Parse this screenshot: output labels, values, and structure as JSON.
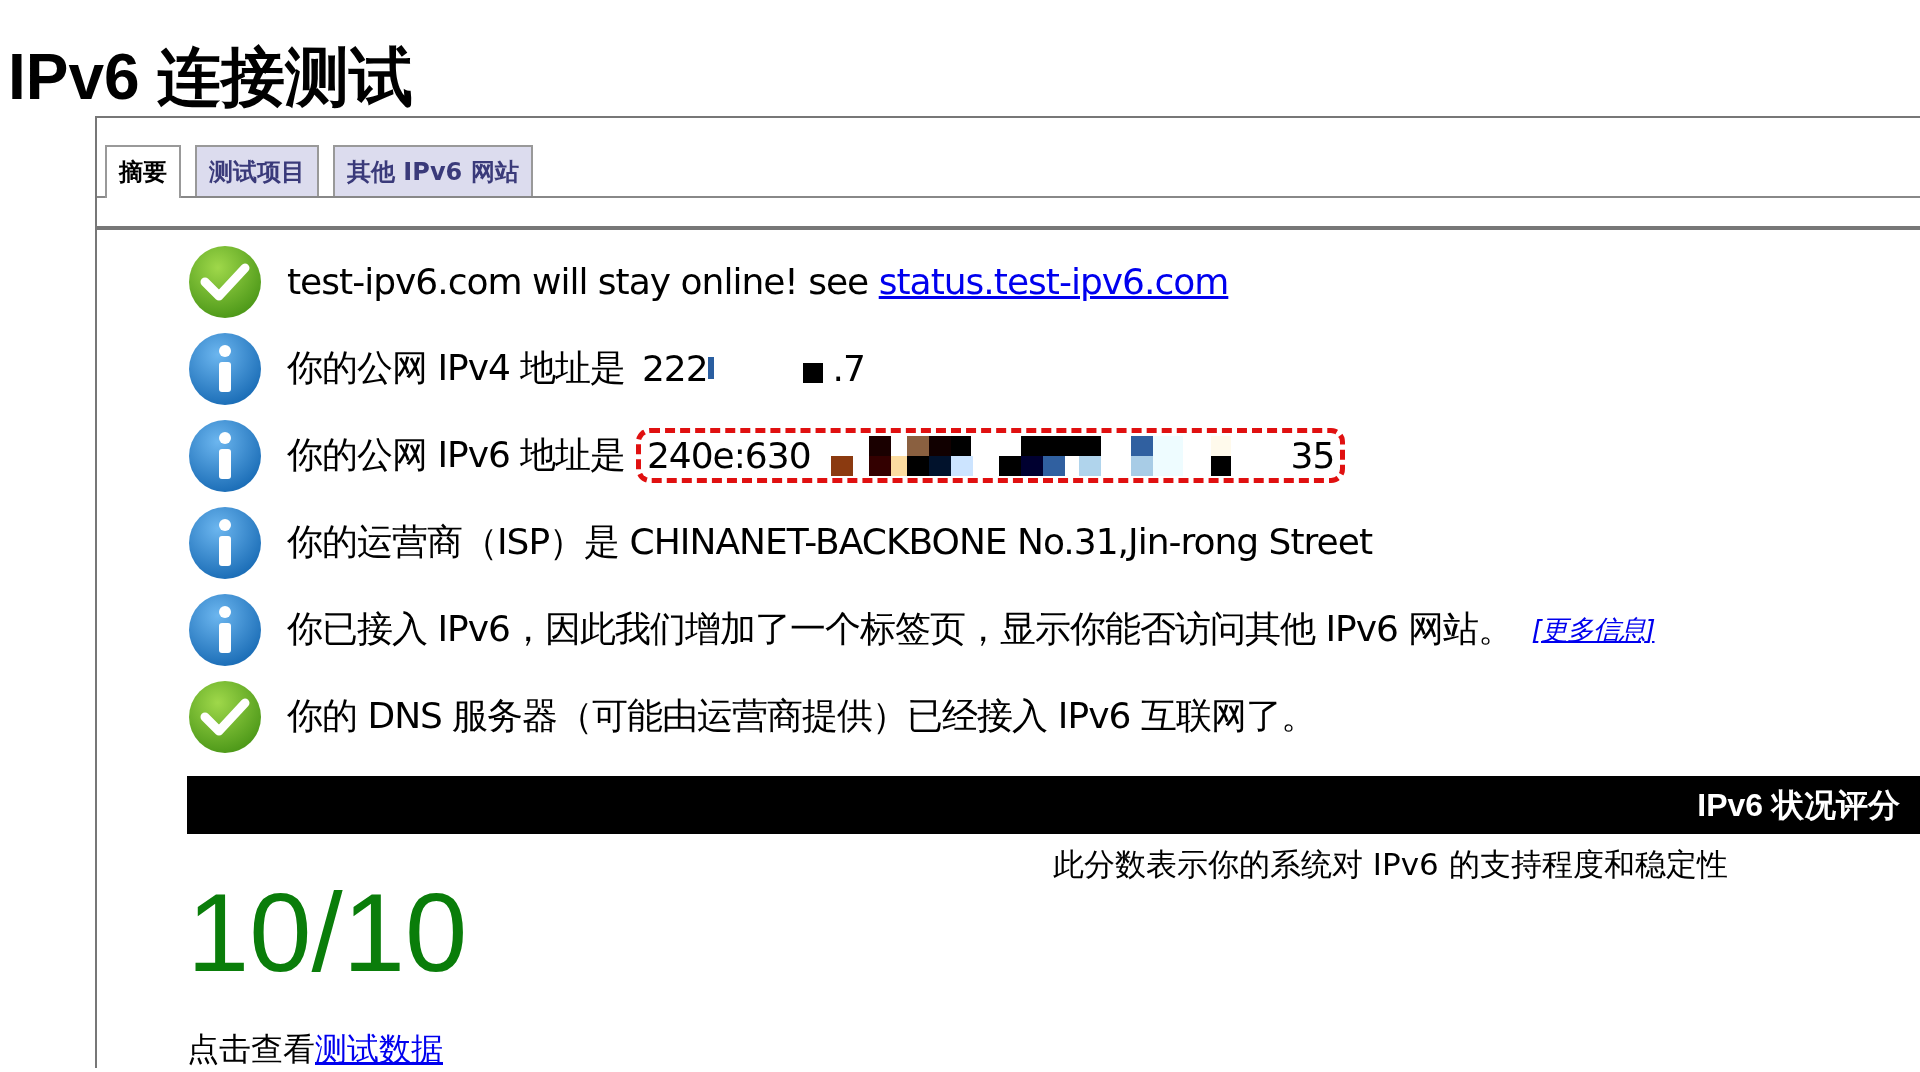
{
  "title": "IPv6 连接测试",
  "tabs": [
    {
      "label": "摘要",
      "selected": true
    },
    {
      "label": "测试项目",
      "selected": false
    },
    {
      "label": "其他 IPv6 网站",
      "selected": false
    }
  ],
  "results": [
    {
      "kind": "ok",
      "parts": [
        {
          "kind": "text",
          "text": "test-ipv6.com will stay online! see "
        },
        {
          "kind": "link",
          "text": "status.test-ipv6.com"
        }
      ]
    },
    {
      "kind": "info",
      "parts": [
        {
          "kind": "text",
          "text": "你的公网 IPv4 地址是 "
        },
        {
          "kind": "group",
          "highlighted": false,
          "parts": [
            {
              "kind": "text",
              "text": "222"
            },
            {
              "kind": "mask"
            },
            {
              "kind": "text",
              "text": ".7"
            }
          ]
        }
      ]
    },
    {
      "kind": "info",
      "parts": [
        {
          "kind": "text",
          "text": "你的公网 IPv6 地址是 "
        },
        {
          "kind": "group",
          "highlighted": true,
          "parts": [
            {
              "kind": "text",
              "text": "240e:630"
            },
            {
              "kind": "mosaic"
            },
            {
              "kind": "text",
              "text": "35"
            }
          ]
        }
      ]
    },
    {
      "kind": "info",
      "parts": [
        {
          "kind": "text",
          "text": "你的运营商（ISP）是 CHINANET-BACKBONE No.31,Jin-rong Street"
        }
      ]
    },
    {
      "kind": "info",
      "parts": [
        {
          "kind": "text",
          "text": "你已接入 IPv6，因此我们增加了一个标签页，显示你能否访问其他 IPv6 网站。"
        },
        {
          "kind": "more",
          "text": "[更多信息]"
        }
      ]
    },
    {
      "kind": "ok",
      "parts": [
        {
          "kind": "text",
          "text": "你的 DNS 服务器（可能由运营商提供）已经接入 IPv6 互联网了。"
        }
      ]
    }
  ],
  "score": {
    "heading": "IPv6 状况评分",
    "description": "此分数表示你的系统对 IPv6 的支持程度和稳定性",
    "value": "10/10"
  },
  "footer": {
    "label": "点击查看 ",
    "link": "测试数据"
  }
}
